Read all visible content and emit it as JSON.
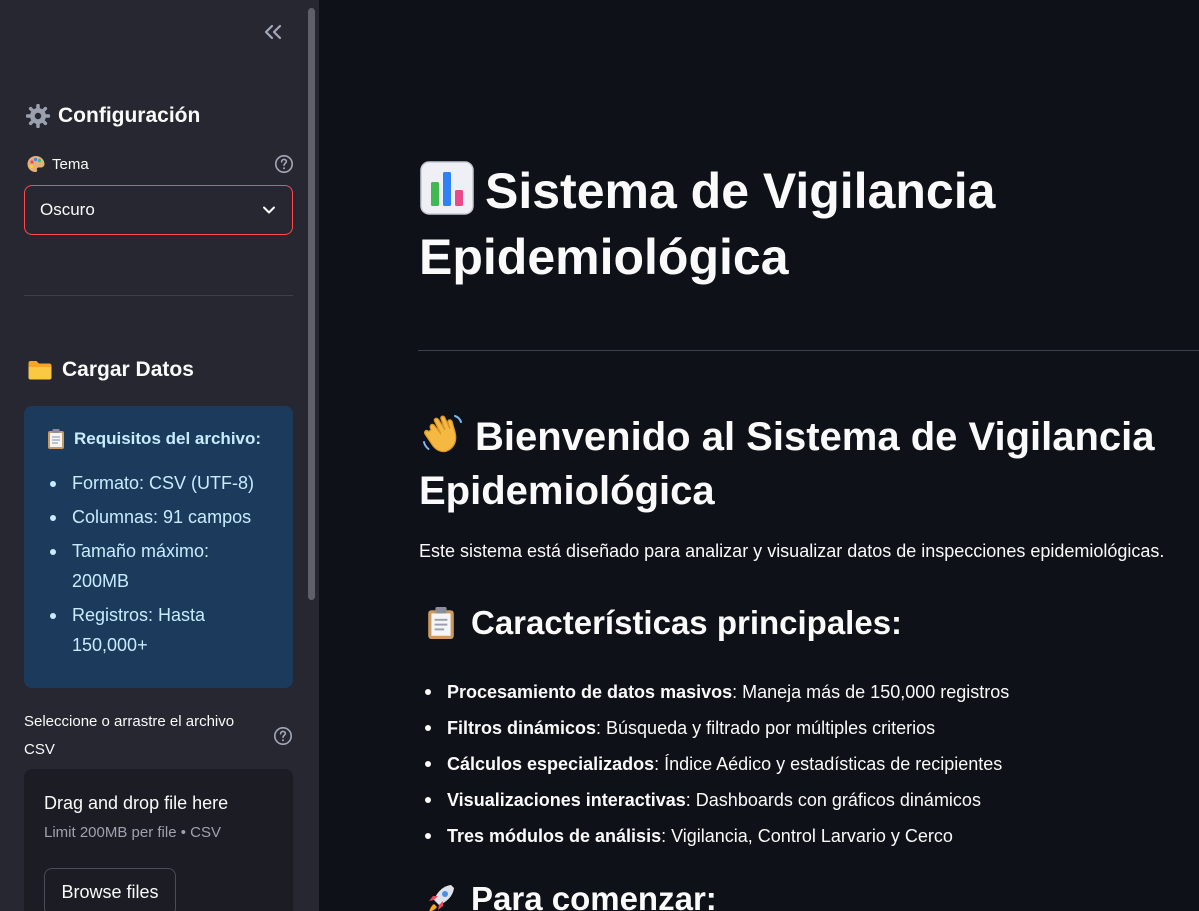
{
  "sidebar": {
    "config_title": "Configuración",
    "theme_label": "Tema",
    "theme_value": "Oscuro",
    "data_title": "Cargar Datos",
    "requirements": {
      "title": "Requisitos del archivo:",
      "items": [
        "Formato: CSV (UTF-8)",
        "Columnas: 91 campos",
        "Tamaño máximo: 200MB",
        "Registros: Hasta 150,000+"
      ]
    },
    "uploader": {
      "label": "Seleccione o arrastre el archivo CSV",
      "drop_title": "Drag and drop file here",
      "drop_sub": "Limit 200MB per file • CSV",
      "browse_label": "Browse files"
    }
  },
  "main": {
    "title": "Sistema de Vigilancia Epidemiológica",
    "welcome": "Bienvenido al Sistema de Vigilancia Epidemiológica",
    "description": "Este sistema está diseñado para analizar y visualizar datos de inspecciones epidemiológicas.",
    "features_title": "Características principales:",
    "features": [
      {
        "bold": "Procesamiento de datos masivos",
        "text": ": Maneja más de 150,000 registros"
      },
      {
        "bold": "Filtros dinámicos",
        "text": ": Búsqueda y filtrado por múltiples criterios"
      },
      {
        "bold": "Cálculos especializados",
        "text": ": Índice Aédico y estadísticas de recipientes"
      },
      {
        "bold": "Visualizaciones interactivas",
        "text": ": Dashboards con gráficos dinámicos"
      },
      {
        "bold": "Tres módulos de análisis",
        "text": ": Vigilancia, Control Larvario y Cerco"
      }
    ],
    "start_title": "Para comenzar:"
  },
  "colors": {
    "background": "#0e1117",
    "sidebar": "#262730",
    "accent": "#ff4b4b",
    "info_bg": "#1c3a5c",
    "info_text": "#c7ebff"
  },
  "icons": [
    "collapse-sidebar-icon",
    "gear-icon",
    "palette-icon",
    "help-icon",
    "chevron-down-icon",
    "folder-icon",
    "clipboard-icon",
    "bar-chart-icon",
    "waving-hand-icon",
    "rocket-icon"
  ]
}
